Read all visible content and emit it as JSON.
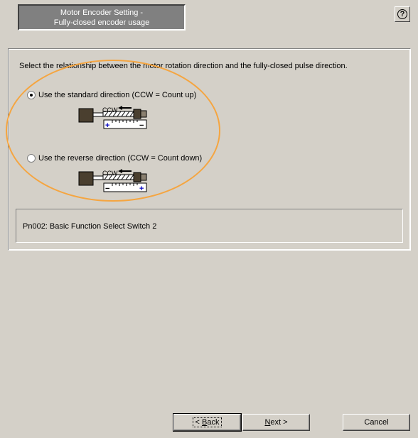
{
  "header": {
    "title_line1": "Motor Encoder Setting -",
    "title_line2": "Fully-closed encoder usage",
    "help_glyph": "?"
  },
  "main": {
    "instruction": "Select the relationship between the motor rotation direction and the fully-closed pulse direction.",
    "options": [
      {
        "label": "Use the standard direction (CCW = Count up)",
        "selected": true,
        "diagram": {
          "arrow_label": "CCW",
          "left_sign": "+",
          "right_sign": "−"
        }
      },
      {
        "label": "Use the reverse direction (CCW = Count down)",
        "selected": false,
        "diagram": {
          "arrow_label": "CCW",
          "left_sign": "−",
          "right_sign": "+"
        }
      }
    ],
    "parameter": "Pn002: Basic Function Select Switch 2"
  },
  "buttons": {
    "back_prefix": "< ",
    "back_mnemonic": "B",
    "back_rest": "ack",
    "next_mnemonic": "N",
    "next_rest": "ext >",
    "cancel": "Cancel"
  },
  "colors": {
    "highlight": "#f5a540",
    "title_bg": "#808080",
    "sign_plus": "#0000c0",
    "motor": "#4a3f2f"
  }
}
